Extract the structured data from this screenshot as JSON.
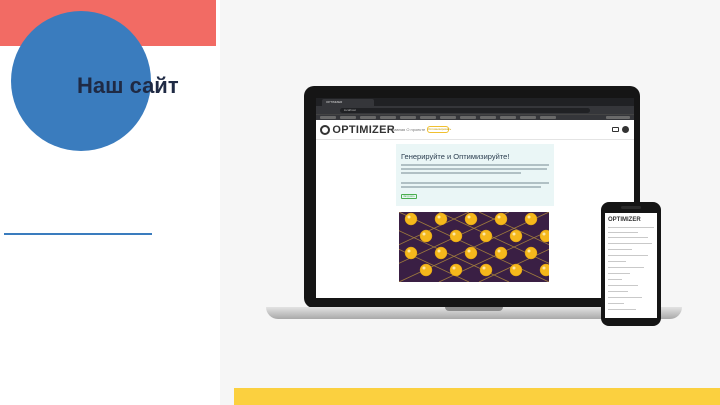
{
  "slide": {
    "title": "Наш сайт"
  },
  "browser": {
    "tab_title": "OPTIMIZER",
    "url": "localhost"
  },
  "site": {
    "logo": "OPTIMIZER",
    "nav_links": "Главная   О проекте",
    "nav_badge": "Оптимизировать",
    "hero_title": "Генерируйте и Оптимизируйте!",
    "hero_button": "Загрузить"
  },
  "phone_site": {
    "logo": "OPTIMIZER"
  },
  "colors": {
    "accent_red": "#f26b64",
    "accent_blue": "#3a7cbe",
    "accent_yellow": "#fbd03f",
    "title_color": "#1f2a44"
  }
}
